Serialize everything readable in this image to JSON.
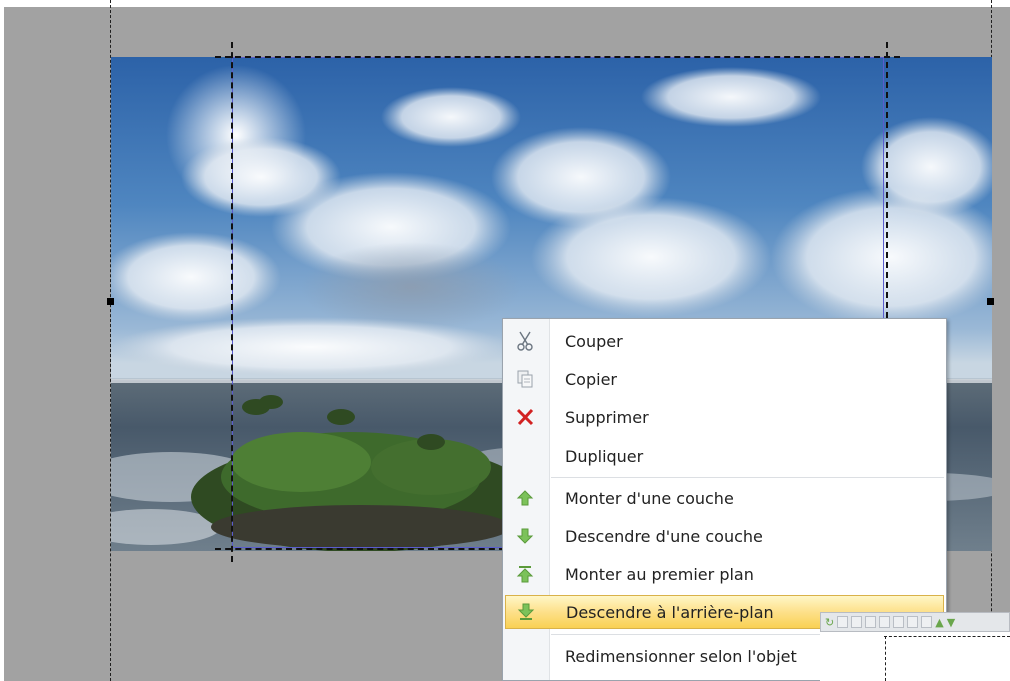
{
  "context_menu": {
    "items": [
      {
        "label": "Couper",
        "icon": "scissors-icon"
      },
      {
        "label": "Copier",
        "icon": "copy-icon"
      },
      {
        "label": "Supprimer",
        "icon": "delete-x-icon"
      },
      {
        "label": "Dupliquer",
        "icon": ""
      },
      {
        "label": "Monter d'une couche",
        "icon": "arrow-up-icon"
      },
      {
        "label": "Descendre d'une couche",
        "icon": "arrow-down-icon"
      },
      {
        "label": "Monter au premier plan",
        "icon": "bring-to-front-icon"
      },
      {
        "label": "Descendre à l'arrière-plan",
        "icon": "send-to-back-icon"
      },
      {
        "label": "Redimensionner selon l'objet",
        "icon": ""
      }
    ],
    "highlighted_index": 7
  },
  "colors": {
    "canvas_background": "#a2a2a2",
    "selection_border": "#5a5ccf",
    "highlight": "#f9d154",
    "delete_icon": "#d22222",
    "arrow_icon": "#7cc25a"
  }
}
